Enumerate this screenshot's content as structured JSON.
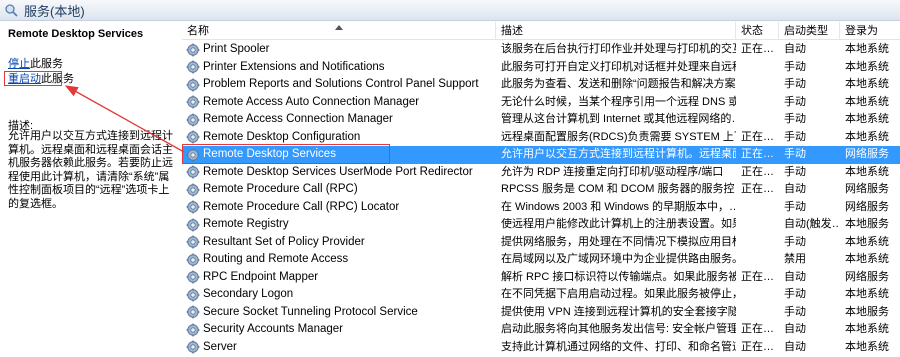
{
  "window": {
    "title": "服务(本地)",
    "icon": "magnifier-gear-icon"
  },
  "left_pane": {
    "service_name": "Remote Desktop Services",
    "stop_prefix": "停止",
    "stop_suffix": "此服务",
    "restart_prefix": "重启动",
    "restart_suffix": "此服务",
    "description_label": "描述:",
    "description": "允许用户以交互方式连接到远程计算机。远程桌面和远程桌面会话主机服务器依赖此服务。若要防止远程使用此计算机，请清除“系统”属性控制面板项目的“远程”选项卡上的复选框。"
  },
  "columns": {
    "name": "名称",
    "description": "描述",
    "status": "状态",
    "startup": "启动类型",
    "logon": "登录为"
  },
  "rows": [
    {
      "name": "Print Spooler",
      "description": "该服务在后台执行打印作业并处理与打印机的交互…",
      "status": "正在…",
      "startup": "自动",
      "logon": "本地系统"
    },
    {
      "name": "Printer Extensions and Notifications",
      "description": "此服务可打开自定义打印机对话框并处理来自远程…",
      "status": "",
      "startup": "手动",
      "logon": "本地系统"
    },
    {
      "name": "Problem Reports and Solutions Control Panel Support",
      "description": "此服务为查看、发送和删除“问题报告和解决方案”…",
      "status": "",
      "startup": "手动",
      "logon": "本地系统"
    },
    {
      "name": "Remote Access Auto Connection Manager",
      "description": "无论什么时候，当某个程序引用一个远程 DNS 或…",
      "status": "",
      "startup": "手动",
      "logon": "本地系统"
    },
    {
      "name": "Remote Access Connection Manager",
      "description": "管理从这台计算机到 Internet 或其他远程网络的…",
      "status": "",
      "startup": "手动",
      "logon": "本地系统"
    },
    {
      "name": "Remote Desktop Configuration",
      "description": "远程桌面配置服务(RDCS)负责需要 SYSTEM 上下…",
      "status": "正在…",
      "startup": "手动",
      "logon": "本地系统"
    },
    {
      "name": "Remote Desktop Services",
      "description": "允许用户以交互方式连接到远程计算机。远程桌面…",
      "status": "正在…",
      "startup": "手动",
      "logon": "网络服务",
      "selected": true
    },
    {
      "name": "Remote Desktop Services UserMode Port Redirector",
      "description": "允许为 RDP 连接重定向打印机/驱动程序/端口",
      "status": "正在…",
      "startup": "手动",
      "logon": "本地系统"
    },
    {
      "name": "Remote Procedure Call (RPC)",
      "description": "RPCSS 服务是 COM 和 DCOM 服务器的服务控…",
      "status": "正在…",
      "startup": "自动",
      "logon": "网络服务"
    },
    {
      "name": "Remote Procedure Call (RPC) Locator",
      "description": "在 Windows 2003 和 Windows 的早期版本中，…",
      "status": "",
      "startup": "手动",
      "logon": "网络服务"
    },
    {
      "name": "Remote Registry",
      "description": "使远程用户能修改此计算机上的注册表设置。如果…",
      "status": "",
      "startup": "自动(触发…",
      "logon": "本地服务"
    },
    {
      "name": "Resultant Set of Policy Provider",
      "description": "提供网络服务，用处理在不同情况下模拟应用目标…",
      "status": "",
      "startup": "手动",
      "logon": "本地系统"
    },
    {
      "name": "Routing and Remote Access",
      "description": "在局域网以及广域网环境中为企业提供路由服务。",
      "status": "",
      "startup": "禁用",
      "logon": "本地系统"
    },
    {
      "name": "RPC Endpoint Mapper",
      "description": "解析 RPC 接口标识符以传输端点。如果此服务被…",
      "status": "正在…",
      "startup": "自动",
      "logon": "网络服务"
    },
    {
      "name": "Secondary Logon",
      "description": "在不同凭据下启用启动过程。如果此服务被停止，…",
      "status": "",
      "startup": "手动",
      "logon": "本地系统"
    },
    {
      "name": "Secure Socket Tunneling Protocol Service",
      "description": "提供使用 VPN 连接到远程计算机的安全套接字隧…",
      "status": "",
      "startup": "手动",
      "logon": "本地服务"
    },
    {
      "name": "Security Accounts Manager",
      "description": "启动此服务将向其他服务发出信号: 安全帐户管理…",
      "status": "正在…",
      "startup": "自动",
      "logon": "本地系统"
    },
    {
      "name": "Server",
      "description": "支持此计算机通过网络的文件、打印、和命名管道…",
      "status": "正在…",
      "startup": "自动",
      "logon": "本地系统"
    }
  ],
  "colors": {
    "selection": "#3399ff",
    "annotation": "#e23a3a",
    "link": "#0645ad"
  }
}
